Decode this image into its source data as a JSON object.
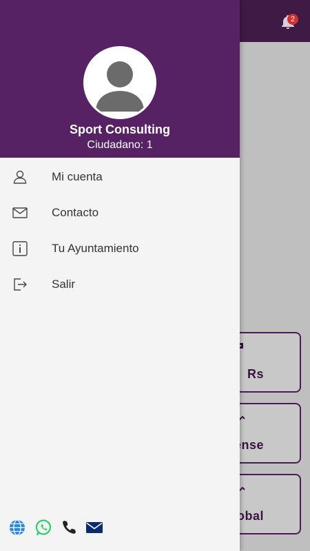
{
  "notifications": {
    "count": "2"
  },
  "background_cards": [
    {
      "label": "Rs"
    },
    {
      "label": "uense"
    },
    {
      "label": "obal"
    }
  ],
  "drawer": {
    "user": {
      "name": "Sport Consulting",
      "subtitle": "Ciudadano: 1"
    },
    "menu": [
      {
        "label": "Mi cuenta",
        "icon": "user-icon"
      },
      {
        "label": "Contacto",
        "icon": "mail-icon"
      },
      {
        "label": "Tu Ayuntamiento",
        "icon": "info-icon"
      },
      {
        "label": "Salir",
        "icon": "logout-icon"
      }
    ],
    "footer_icons": [
      "globe-icon",
      "whatsapp-icon",
      "phone-icon",
      "email-icon"
    ]
  },
  "colors": {
    "header_purple": "#562264",
    "background_header": "#3f1a44",
    "badge_red": "#d32f2f"
  }
}
